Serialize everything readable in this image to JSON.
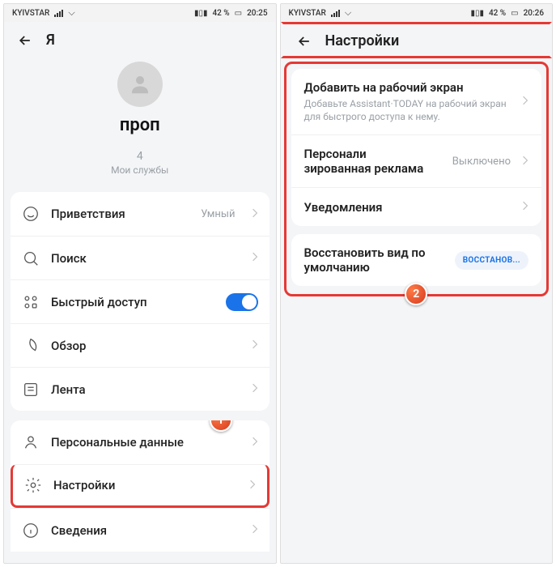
{
  "status": {
    "carrier": "KYIVSTAR",
    "battery_pct": "42 %",
    "time_left": "20:25",
    "time_right": "20:26"
  },
  "left": {
    "header_title": "Я",
    "username": "проп",
    "services_count": "4",
    "services_label": "Мои службы",
    "rows": {
      "greetings": {
        "label": "Приветствия",
        "value": "Умный"
      },
      "search": {
        "label": "Поиск"
      },
      "quick": {
        "label": "Быстрый доступ"
      },
      "overview": {
        "label": "Обзор"
      },
      "feed": {
        "label": "Лента"
      },
      "personal": {
        "label": "Персональные данные"
      },
      "settings": {
        "label": "Настройки"
      },
      "about": {
        "label": "Сведения"
      }
    },
    "step": "1"
  },
  "right": {
    "header_title": "Настройки",
    "add_home": {
      "title": "Добавить на рабочий экран",
      "sub": "Добавьте Assistant·TODAY на рабочий экран для быстрого доступа к нему."
    },
    "ads": {
      "title": "Персонали\nзированная реклама",
      "value": "Выключено"
    },
    "notif": {
      "title": "Уведомления"
    },
    "restore": {
      "title": "Восстановить вид по умолчанию",
      "btn": "ВОССТАНОВ..."
    },
    "step": "2"
  }
}
